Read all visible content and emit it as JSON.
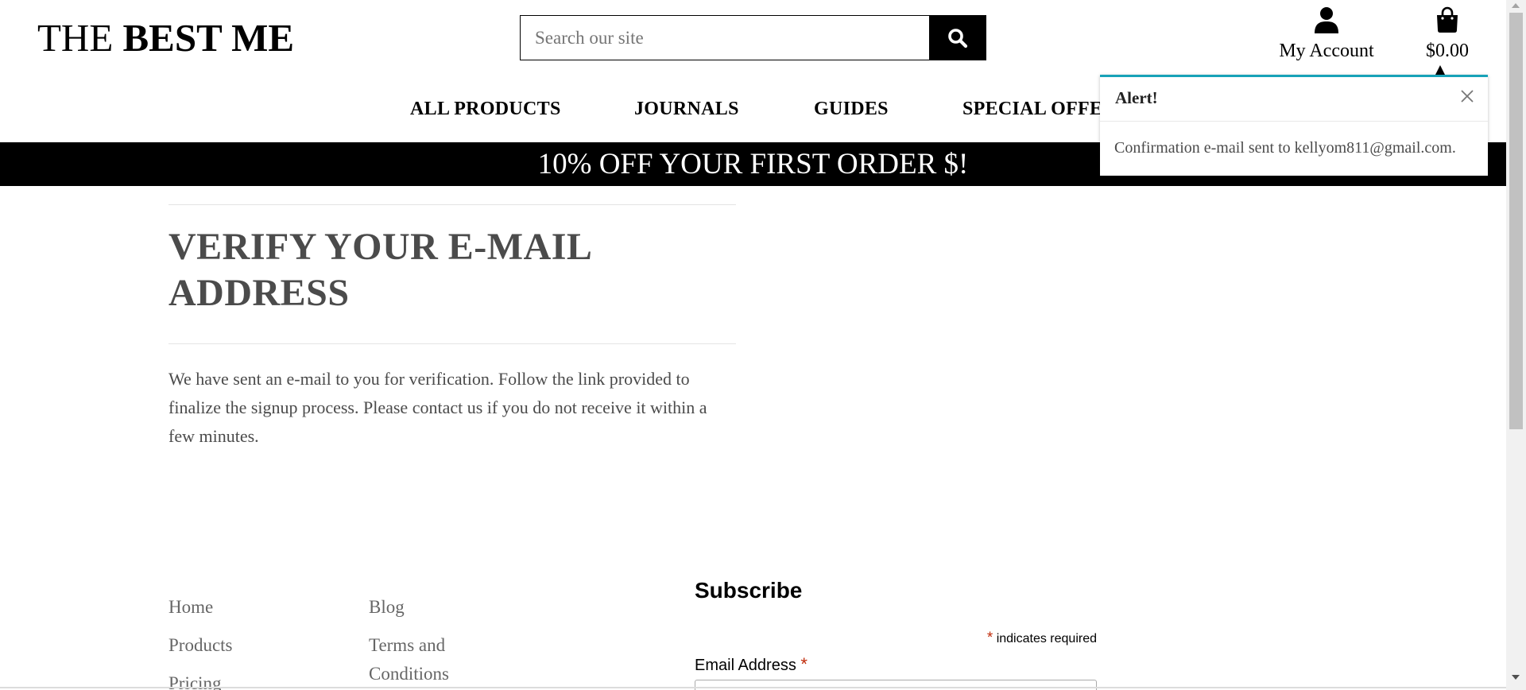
{
  "header": {
    "logo_light": "THE",
    "logo_bold": "BEST ME",
    "search_placeholder": "Search our site",
    "account_label": "My Account",
    "bag_total": "$0.00"
  },
  "nav": {
    "items": [
      "ALL PRODUCTS",
      "JOURNALS",
      "GUIDES",
      "SPECIAL OFFERS"
    ]
  },
  "banner": {
    "text": "10% OFF YOUR FIRST ORDER $!"
  },
  "main": {
    "title": "VERIFY YOUR E-MAIL ADDRESS",
    "body": "We have sent an e-mail to you for verification. Follow the link provided to finalize the signup process. Please contact us if you do not receive it within a few minutes."
  },
  "alert": {
    "heading": "Alert!",
    "message": "Confirmation e-mail sent to kellyom811@gmail.com.",
    "accent_color": "#17a2b8"
  },
  "footer": {
    "col1": [
      "Home",
      "Products",
      "Pricing"
    ],
    "col2": [
      "Blog",
      "Terms and Conditions"
    ],
    "subscribe": {
      "heading": "Subscribe",
      "required_marker": "*",
      "required_note": "indicates required",
      "email_label": "Email Address"
    }
  },
  "icons": {
    "search": "search-icon",
    "account": "user-icon",
    "bag": "shopping-bag-icon",
    "close": "close-icon"
  }
}
